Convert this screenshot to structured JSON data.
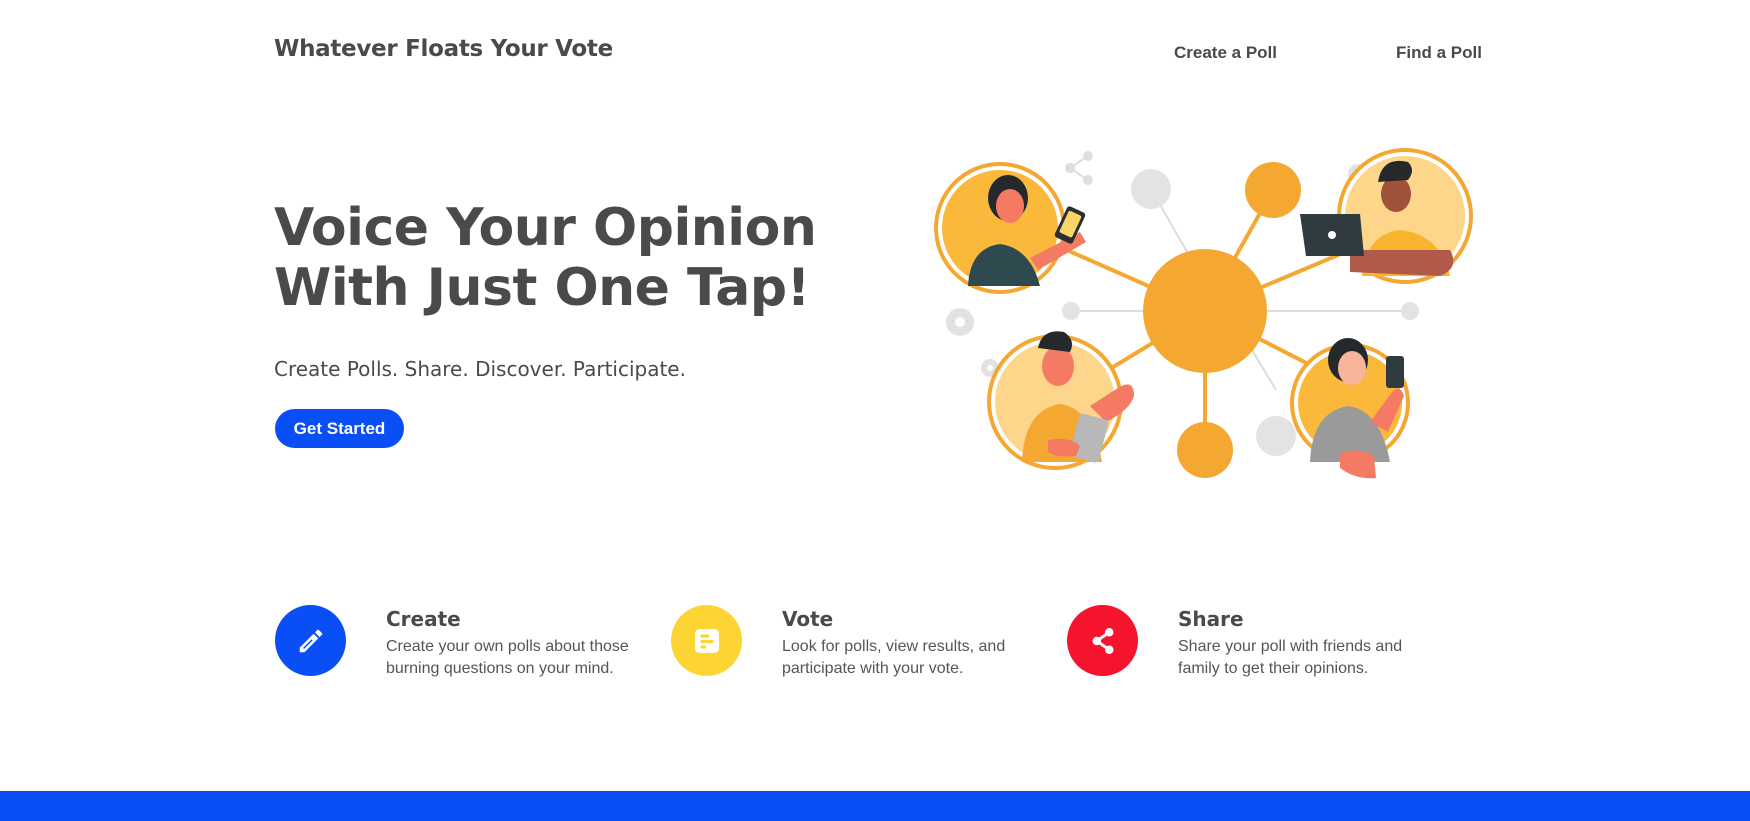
{
  "header": {
    "brand": "Whatever Floats Your Vote",
    "nav": [
      {
        "label": "Create a Poll"
      },
      {
        "label": "Find a Poll"
      }
    ]
  },
  "hero": {
    "title_line1": "Voice Your Opinion",
    "title_line2": "With Just One Tap!",
    "subtitle": "Create Polls. Share. Discover. Participate.",
    "cta_label": "Get Started"
  },
  "features": [
    {
      "title": "Create",
      "description": "Create your own polls about those burning questions on your mind.",
      "icon": "pencil-icon",
      "color": "#0a4ef5"
    },
    {
      "title": "Vote",
      "description": "Look for polls, view results, and participate with your vote.",
      "icon": "poll-icon",
      "color": "#fcd535"
    },
    {
      "title": "Share",
      "description": "Share your poll with friends and family to get their opinions.",
      "icon": "share-icon",
      "color": "#f5142d"
    }
  ],
  "colors": {
    "primary": "#0a4ef5",
    "text": "#4a4a4a",
    "accent_orange": "#f4a832",
    "vote_yellow": "#fcd535",
    "share_red": "#f5142d"
  }
}
